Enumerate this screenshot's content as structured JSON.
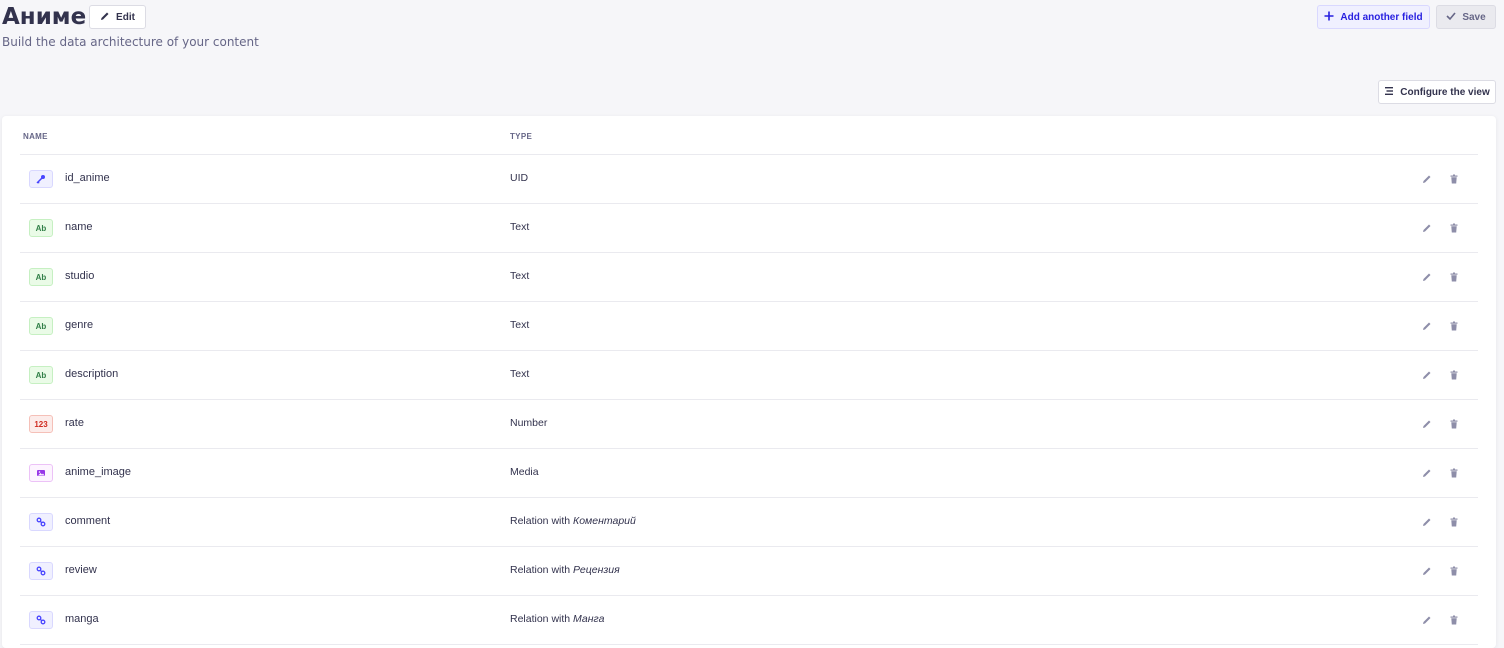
{
  "header": {
    "title": "Аниме",
    "edit_label": "Edit",
    "subtitle": "Build the data architecture of your content",
    "add_field_label": "Add another field",
    "save_label": "Save",
    "configure_label": "Configure the view"
  },
  "table": {
    "columns": [
      "NAME",
      "TYPE"
    ],
    "rows": [
      {
        "badge": "",
        "name": "id_anime",
        "type": "UID",
        "relation_target": ""
      },
      {
        "badge": "Ab",
        "name": "name",
        "type": "Text",
        "relation_target": ""
      },
      {
        "badge": "Ab",
        "name": "studio",
        "type": "Text",
        "relation_target": ""
      },
      {
        "badge": "Ab",
        "name": "genre",
        "type": "Text",
        "relation_target": ""
      },
      {
        "badge": "Ab",
        "name": "description",
        "type": "Text",
        "relation_target": ""
      },
      {
        "badge": "123",
        "name": "rate",
        "type": "Number",
        "relation_target": ""
      },
      {
        "badge": "",
        "name": "anime_image",
        "type": "Media",
        "relation_target": ""
      },
      {
        "badge": "",
        "name": "comment",
        "type": "Relation with ",
        "relation_target": "Коментарий"
      },
      {
        "badge": "",
        "name": "review",
        "type": "Relation with ",
        "relation_target": "Рецензия"
      },
      {
        "badge": "",
        "name": "manga",
        "type": "Relation with ",
        "relation_target": "Манга"
      }
    ]
  },
  "colors": {
    "primary": "#4945ff",
    "text": "#32324d",
    "muted": "#666687"
  }
}
